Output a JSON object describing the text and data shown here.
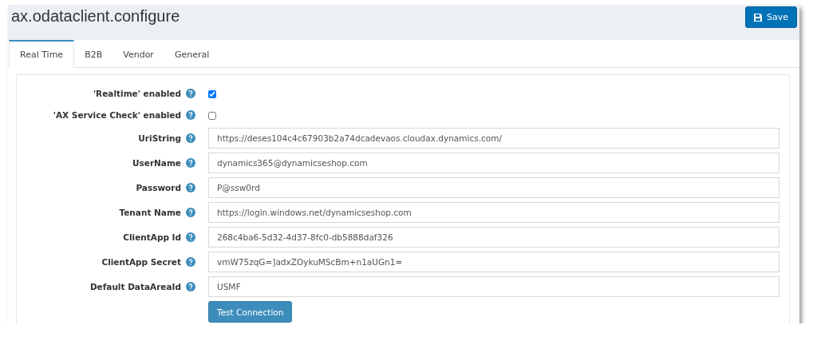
{
  "page": {
    "title": "ax.odataclient.configure"
  },
  "save_button": {
    "label": "Save"
  },
  "tabs": [
    {
      "label": "Real Time",
      "selected": true
    },
    {
      "label": "B2B",
      "selected": false
    },
    {
      "label": "Vendor",
      "selected": false
    },
    {
      "label": "General",
      "selected": false
    }
  ],
  "fields": [
    {
      "kind": "checkbox",
      "label": "'Realtime' enabled",
      "checked": true
    },
    {
      "kind": "checkbox",
      "label": "'AX Service Check' enabled",
      "checked": false
    },
    {
      "kind": "text",
      "label": "UriString",
      "value": "https://deses104c4c67903b2a74dcadevaos.cloudax.dynamics.com/"
    },
    {
      "kind": "text",
      "label": "UserName",
      "value": "dynamics365@dynamicseshop.com"
    },
    {
      "kind": "text",
      "label": "Password",
      "value": "P@ssw0rd"
    },
    {
      "kind": "text",
      "label": "Tenant Name",
      "value": "https://login.windows.net/dynamicseshop.com"
    },
    {
      "kind": "text",
      "label": "ClientApp Id",
      "value": "268c4ba6-5d32-4d37-8fc0-db5888daf326"
    },
    {
      "kind": "text",
      "label": "ClientApp Secret",
      "value": "vmW75zqG=]adxZOykuMScBm+n1aUGn1="
    },
    {
      "kind": "text",
      "label": "Default DataAreaId",
      "value": "USMF"
    }
  ],
  "test_button": {
    "label": "Test Connection"
  }
}
